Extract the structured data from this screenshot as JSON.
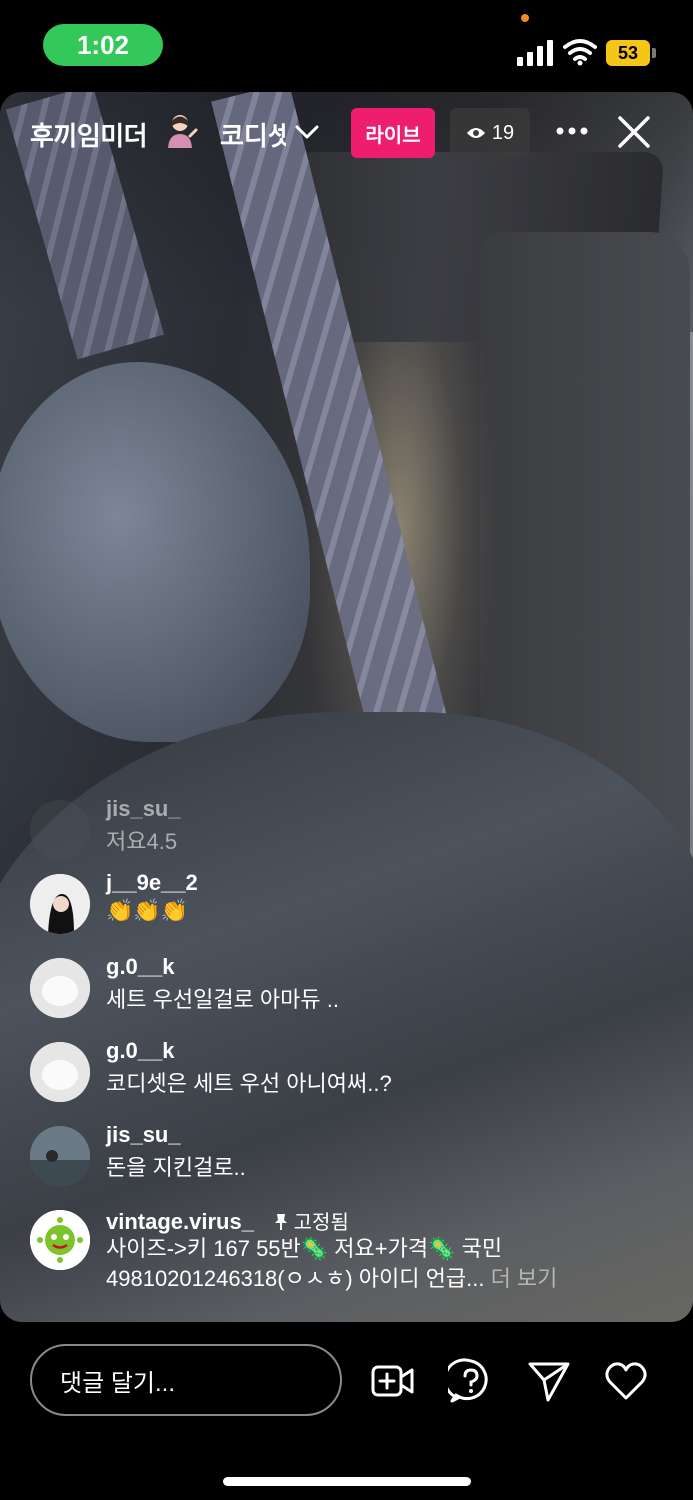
{
  "status_bar": {
    "time": "1:02",
    "battery": "53"
  },
  "live": {
    "host_name": "후끼임미더",
    "title": "코디셋",
    "live_label": "라이브",
    "viewer_count": "19"
  },
  "comments": [
    {
      "user": "jis_su_",
      "text": "저요4.5"
    },
    {
      "user": "j__9e__2",
      "text": "👏👏👏"
    },
    {
      "user": "g.0__k",
      "text": "세트 우선일걸로 아마듀 .."
    },
    {
      "user": "g.0__k",
      "text": "코디셋은 세트 우선 아니여써..?"
    },
    {
      "user": "jis_su_",
      "text": "돈을 지킨걸로.."
    }
  ],
  "pinned_comment": {
    "user": "vintage.virus_",
    "pinned_label": "고정됨",
    "line1": "사이즈->키 167 55반🦠 저요+가격🦠 국민",
    "line2": "49810201246318(ㅇㅅㅎ) 아이디 언급...",
    "more": "더 보기"
  },
  "bottom_bar": {
    "comment_placeholder": "댓글 달기..."
  },
  "colors": {
    "live_badge": "#ee1d70",
    "time_pill": "#34c759",
    "battery": "#f5c518"
  }
}
